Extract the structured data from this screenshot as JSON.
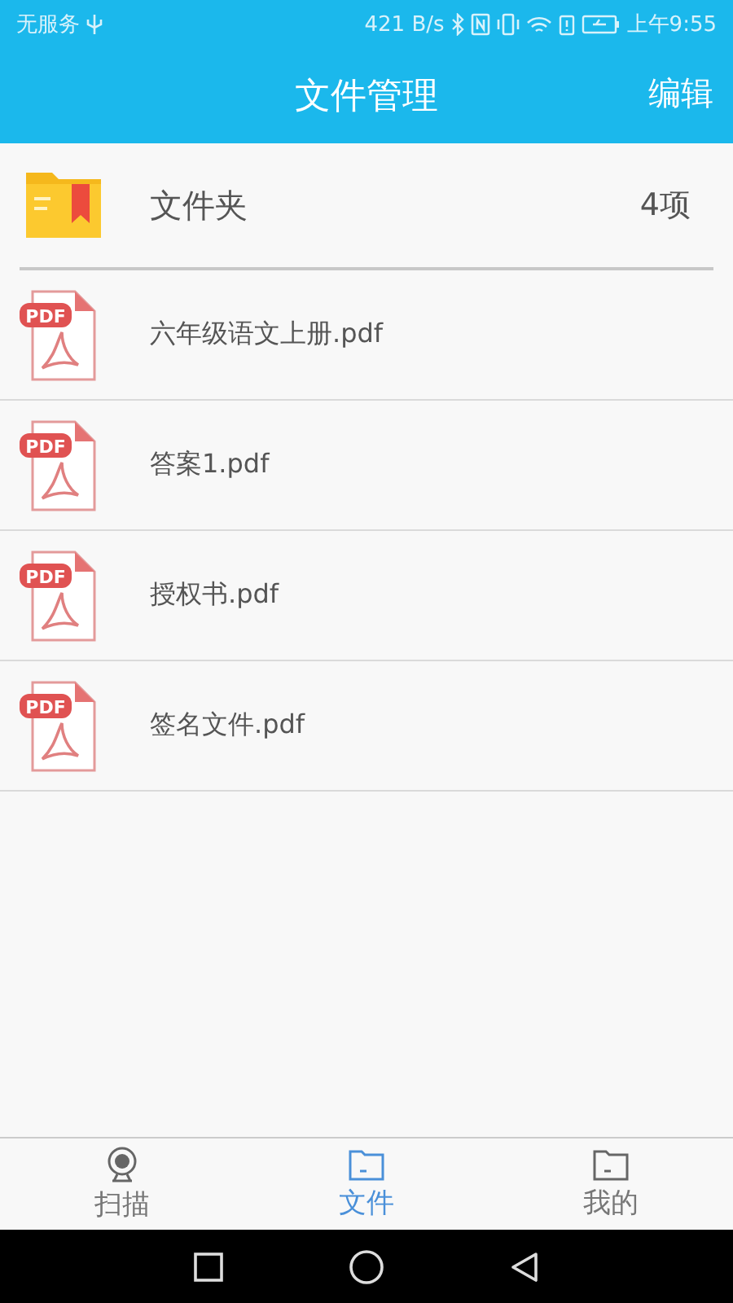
{
  "status_bar": {
    "carrier": "无服务",
    "speed": "421 B/s",
    "time": "上午9:55"
  },
  "header": {
    "title": "文件管理",
    "action": "编辑"
  },
  "folder": {
    "name": "文件夹",
    "count": "4项"
  },
  "files": [
    {
      "name": "六年级语文上册.pdf",
      "badge": "PDF"
    },
    {
      "name": "答案1.pdf",
      "badge": "PDF"
    },
    {
      "name": "授权书.pdf",
      "badge": "PDF"
    },
    {
      "name": "签名文件.pdf",
      "badge": "PDF"
    }
  ],
  "tabs": [
    {
      "label": "扫描",
      "kind": "camera",
      "selected": false
    },
    {
      "label": "文件",
      "kind": "folder",
      "selected": true
    },
    {
      "label": "我的",
      "kind": "folder",
      "selected": false
    }
  ]
}
